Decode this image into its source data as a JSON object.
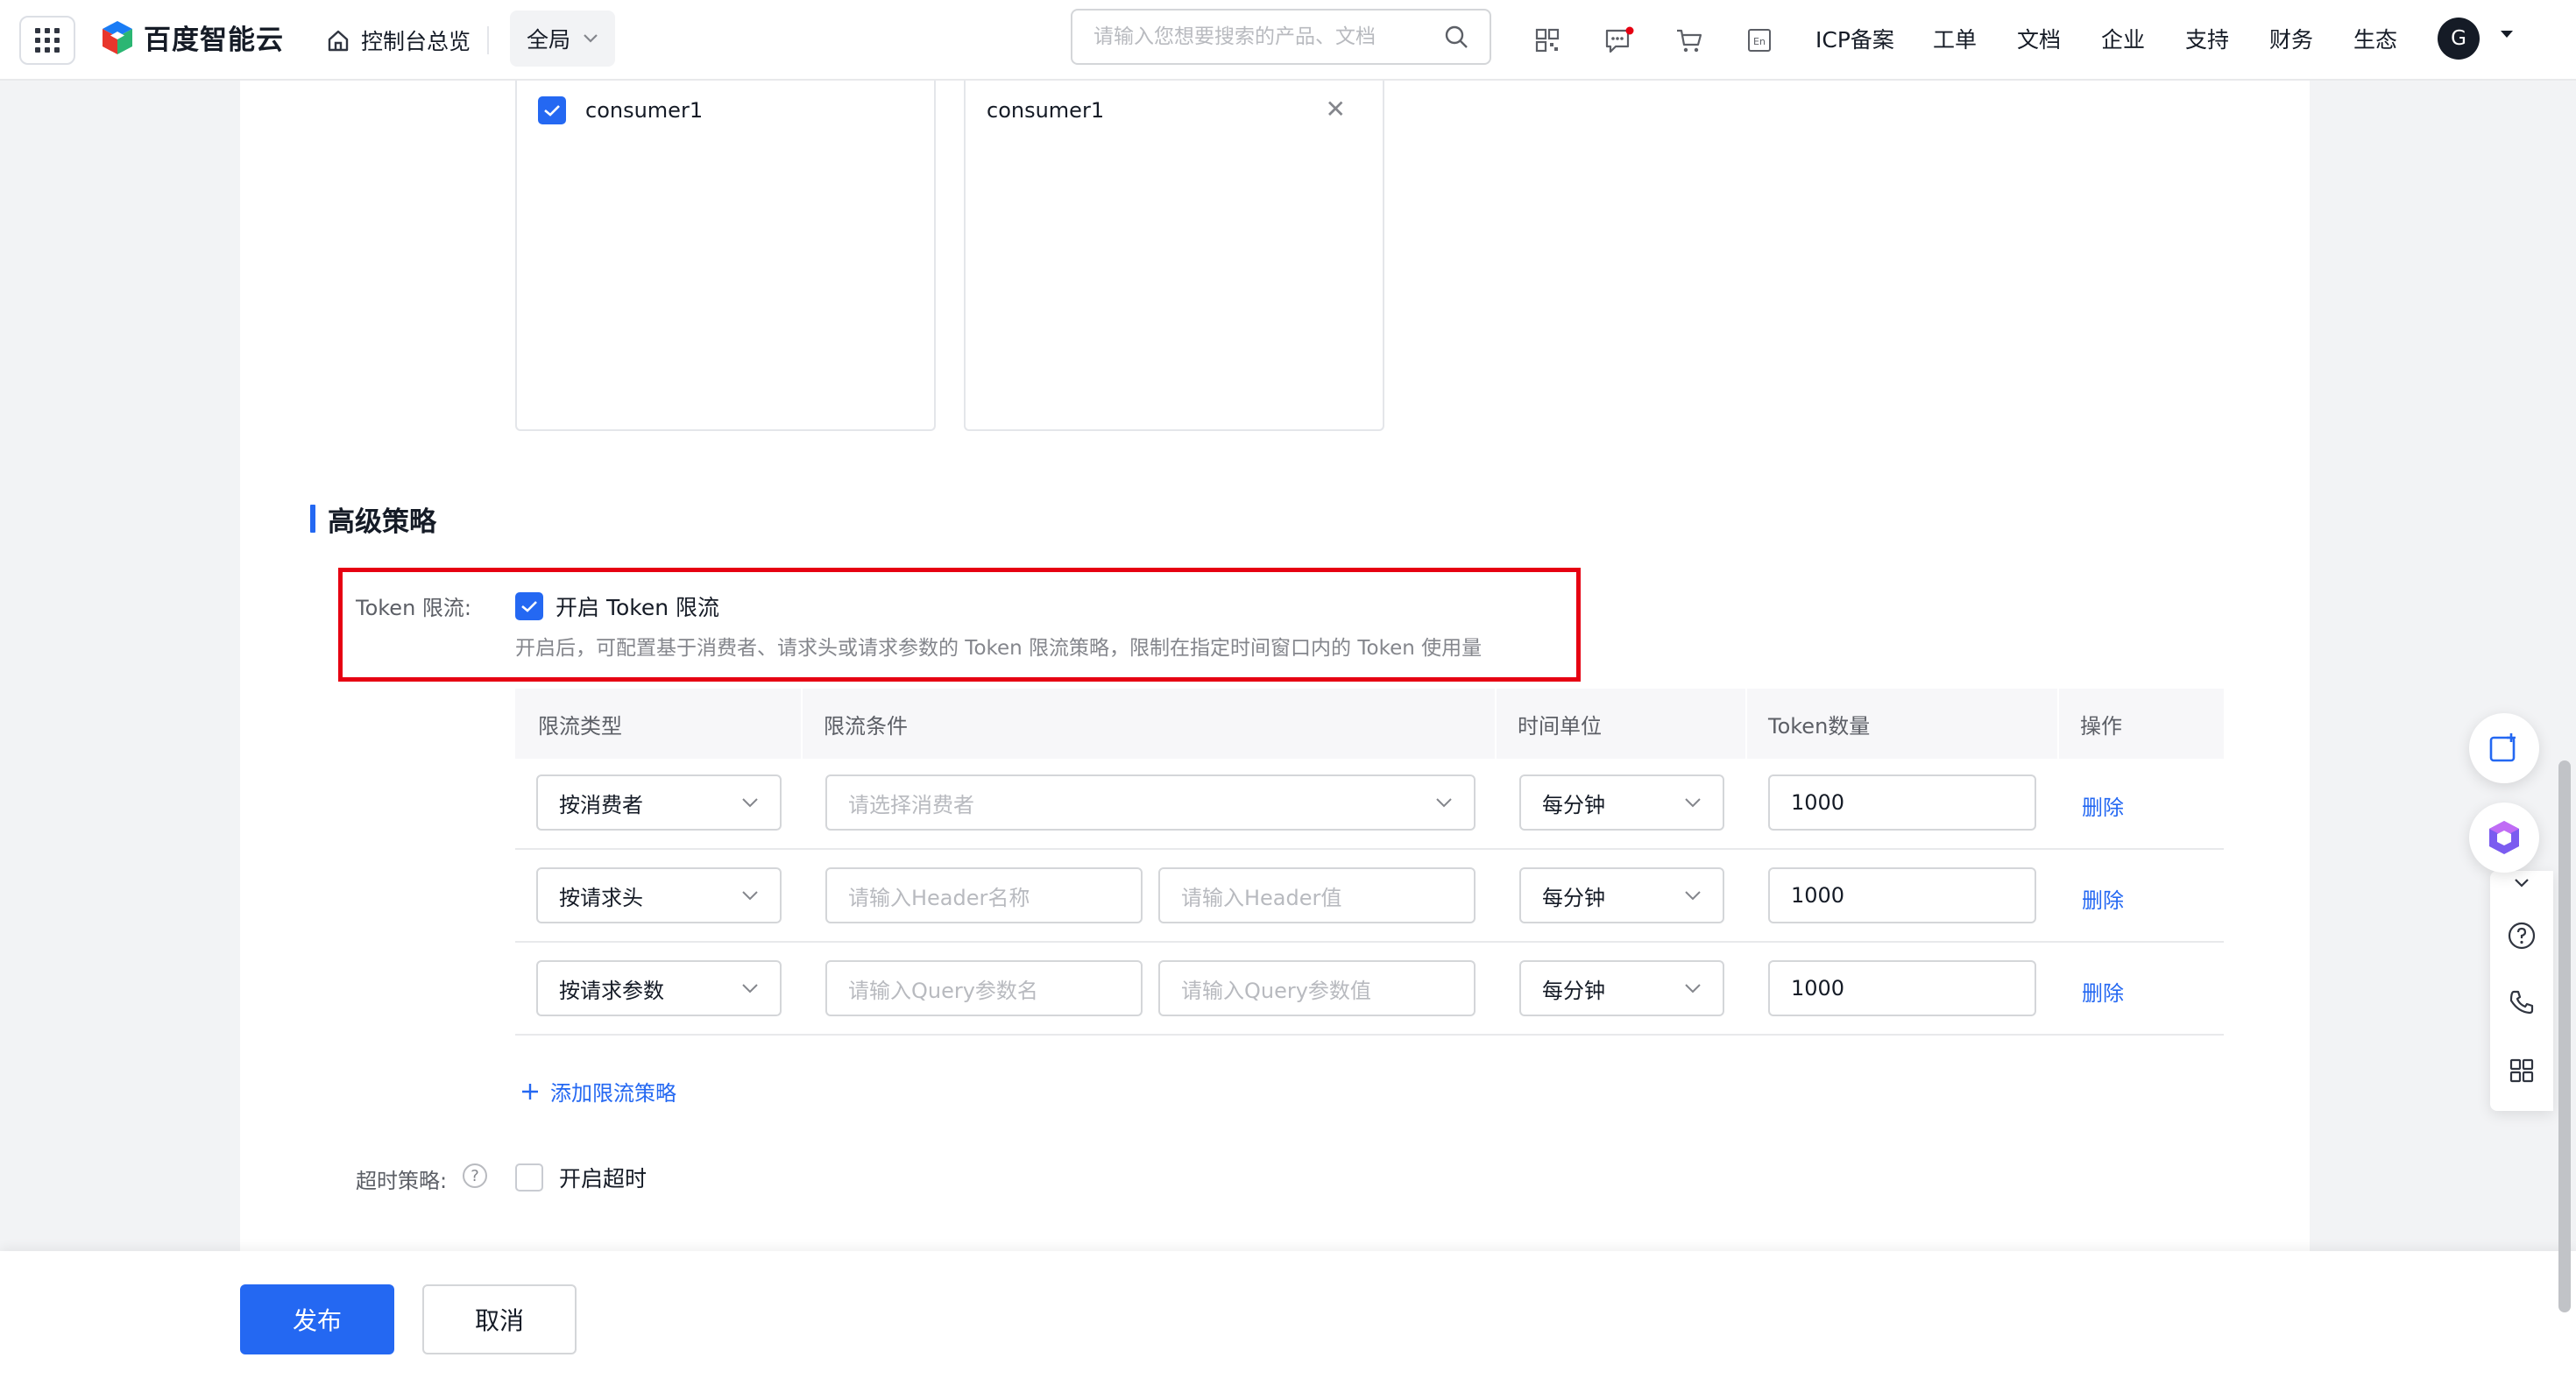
{
  "topbar": {
    "brand": "百度智能云",
    "home_label": "控制台总览",
    "scope_label": "全局",
    "search_placeholder": "请输入您想要搜索的产品、文档",
    "nav": [
      "ICP备案",
      "工单",
      "文档",
      "企业",
      "支持",
      "财务",
      "生态"
    ],
    "avatar_letter": "G",
    "notification_dot_color": "#e60012"
  },
  "consumer_select": {
    "left_item": "consumer1",
    "right_item": "consumer1"
  },
  "advanced": {
    "title": "高级策略",
    "token_label": "Token 限流:",
    "enable_label": "开启 Token 限流",
    "helper": "开启后，可配置基于消费者、请求头或请求参数的 Token 限流策略，限制在指定时间窗口内的 Token 使用量",
    "table": {
      "headers": [
        "限流类型",
        "限流条件",
        "时间单位",
        "Token数量",
        "操作"
      ],
      "rows": [
        {
          "type": "按消费者",
          "cond_placeholder": "请选择消费者",
          "unit": "每分钟",
          "count": "1000",
          "action": "删除"
        },
        {
          "type": "按请求头",
          "cond_placeholder_1": "请输入Header名称",
          "cond_placeholder_2": "请输入Header值",
          "unit": "每分钟",
          "count": "1000",
          "action": "删除"
        },
        {
          "type": "按请求参数",
          "cond_placeholder_1": "请输入Query参数名",
          "cond_placeholder_2": "请输入Query参数值",
          "unit": "每分钟",
          "count": "1000",
          "action": "删除"
        }
      ]
    },
    "add_label": "添加限流策略",
    "timeout_label": "超时策略:",
    "timeout_option": "开启超时"
  },
  "footer": {
    "publish": "发布",
    "cancel": "取消"
  },
  "colors": {
    "accent": "#2468f2",
    "highlight_border": "#e60012"
  }
}
